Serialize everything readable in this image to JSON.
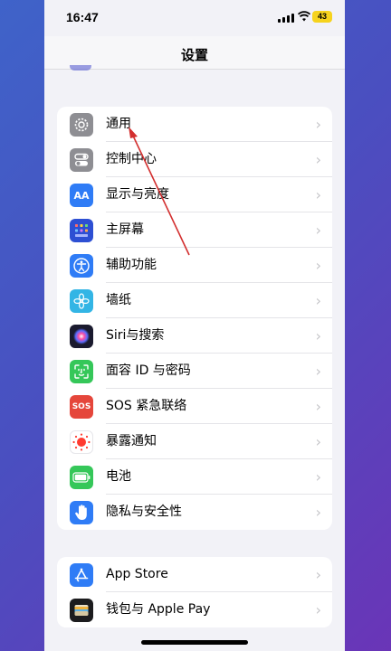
{
  "status": {
    "time": "16:47",
    "battery": "43"
  },
  "nav": {
    "title": "设置"
  },
  "group1": [
    {
      "label": "通用",
      "icon": "gear-icon",
      "color": "#8e8e93"
    },
    {
      "label": "控制中心",
      "icon": "switches-icon",
      "color": "#8e8e93"
    },
    {
      "label": "显示与亮度",
      "icon": "text-size-icon",
      "color": "#2f7cf6",
      "glyph": "AA"
    },
    {
      "label": "主屏幕",
      "icon": "home-grid-icon",
      "color": "#2d4fd3"
    },
    {
      "label": "辅助功能",
      "icon": "accessibility-icon",
      "color": "#2f7cf6"
    },
    {
      "label": "墙纸",
      "icon": "wallpaper-flower-icon",
      "color": "#33b5e5"
    },
    {
      "label": "Siri与搜索",
      "icon": "siri-icon",
      "color": "#1a1a2e"
    },
    {
      "label": "面容 ID 与密码",
      "icon": "face-id-icon",
      "color": "#35c759"
    },
    {
      "label": "SOS 紧急联络",
      "icon": "sos-icon",
      "color": "#e5463b",
      "glyph": "SOS"
    },
    {
      "label": "暴露通知",
      "icon": "exposure-icon",
      "color": "#ffffff"
    },
    {
      "label": "电池",
      "icon": "battery-icon",
      "color": "#35c759"
    },
    {
      "label": "隐私与安全性",
      "icon": "hand-icon",
      "color": "#2f7cf6"
    }
  ],
  "group2": [
    {
      "label": "App Store",
      "icon": "app-store-icon",
      "color": "#2f7cf6"
    },
    {
      "label": "钱包与 Apple Pay",
      "icon": "wallet-icon",
      "color": "#1c1c1e"
    }
  ],
  "chevron": "›"
}
